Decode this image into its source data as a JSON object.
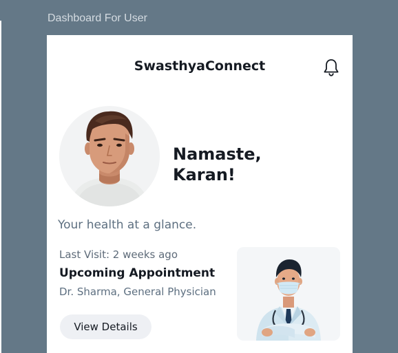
{
  "frame_label": "Dashboard For User",
  "header": {
    "app_name": "SwasthyaConnect",
    "notification_icon": "bell-icon"
  },
  "profile": {
    "avatar": "user-avatar",
    "greeting_line1": "Namaste,",
    "greeting_line2": "Karan!"
  },
  "tagline": "Your health at a glance.",
  "appointment": {
    "last_visit": "Last Visit: 2 weeks ago",
    "title": "Upcoming Appointment",
    "doctor": "Dr. Sharma, General Physician",
    "button_label": "View Details",
    "doctor_image": "doctor-illustration"
  },
  "colors": {
    "canvas": "#647887",
    "card": "#ffffff",
    "text_primary": "#151a22",
    "text_secondary": "#5d6f80",
    "button_bg": "#eef0f4"
  }
}
